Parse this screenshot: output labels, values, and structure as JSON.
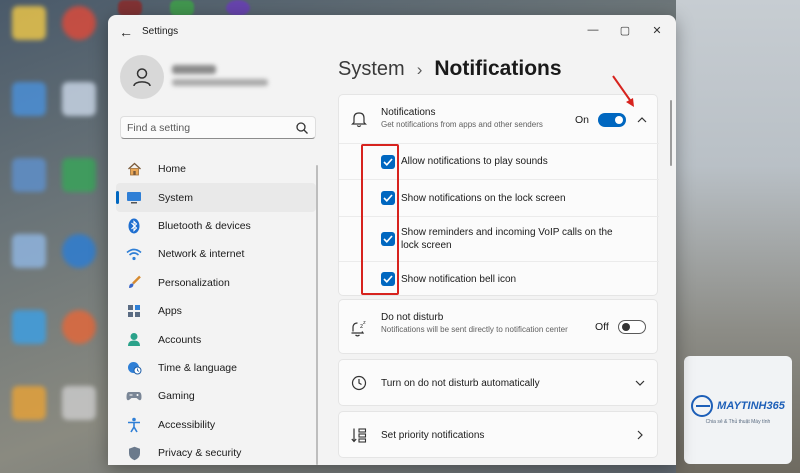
{
  "window": {
    "app_title": "Settings",
    "back_glyph": "←",
    "minimize_glyph": "—",
    "maximize_glyph": "▢",
    "close_glyph": "✕"
  },
  "search": {
    "placeholder": "Find a setting"
  },
  "sidebar": {
    "items": [
      {
        "label": "Home",
        "icon": "home-icon",
        "active": false
      },
      {
        "label": "System",
        "icon": "system-icon",
        "active": true
      },
      {
        "label": "Bluetooth & devices",
        "icon": "bluetooth-icon",
        "active": false
      },
      {
        "label": "Network & internet",
        "icon": "wifi-icon",
        "active": false
      },
      {
        "label": "Personalization",
        "icon": "brush-icon",
        "active": false
      },
      {
        "label": "Apps",
        "icon": "apps-icon",
        "active": false
      },
      {
        "label": "Accounts",
        "icon": "person-icon",
        "active": false
      },
      {
        "label": "Time & language",
        "icon": "globe-clock-icon",
        "active": false
      },
      {
        "label": "Gaming",
        "icon": "gamepad-icon",
        "active": false
      },
      {
        "label": "Accessibility",
        "icon": "accessibility-icon",
        "active": false
      },
      {
        "label": "Privacy & security",
        "icon": "shield-icon",
        "active": false
      }
    ]
  },
  "breadcrumb": {
    "parent": "System",
    "separator": "›",
    "current": "Notifications"
  },
  "notifications": {
    "title": "Notifications",
    "subtitle": "Get notifications from apps and other senders",
    "toggle_label": "On",
    "toggle_on": true,
    "options": [
      {
        "label": "Allow notifications to play sounds",
        "checked": true
      },
      {
        "label": "Show notifications on the lock screen",
        "checked": true
      },
      {
        "label": "Show reminders and incoming VoIP calls on the lock screen",
        "checked": true
      },
      {
        "label": "Show notification bell icon",
        "checked": true
      }
    ]
  },
  "dnd": {
    "title": "Do not disturb",
    "subtitle": "Notifications will be sent directly to notification center",
    "toggle_label": "Off",
    "toggle_on": false
  },
  "dnd_auto": {
    "title": "Turn on do not disturb automatically"
  },
  "priority": {
    "title": "Set priority notifications"
  },
  "watermark": {
    "brand": "MAYTINH365",
    "tagline": "Chia sẻ & Thủ thuật Máy tính"
  },
  "colors": {
    "accent": "#0067c0",
    "highlight": "#d7231e"
  }
}
